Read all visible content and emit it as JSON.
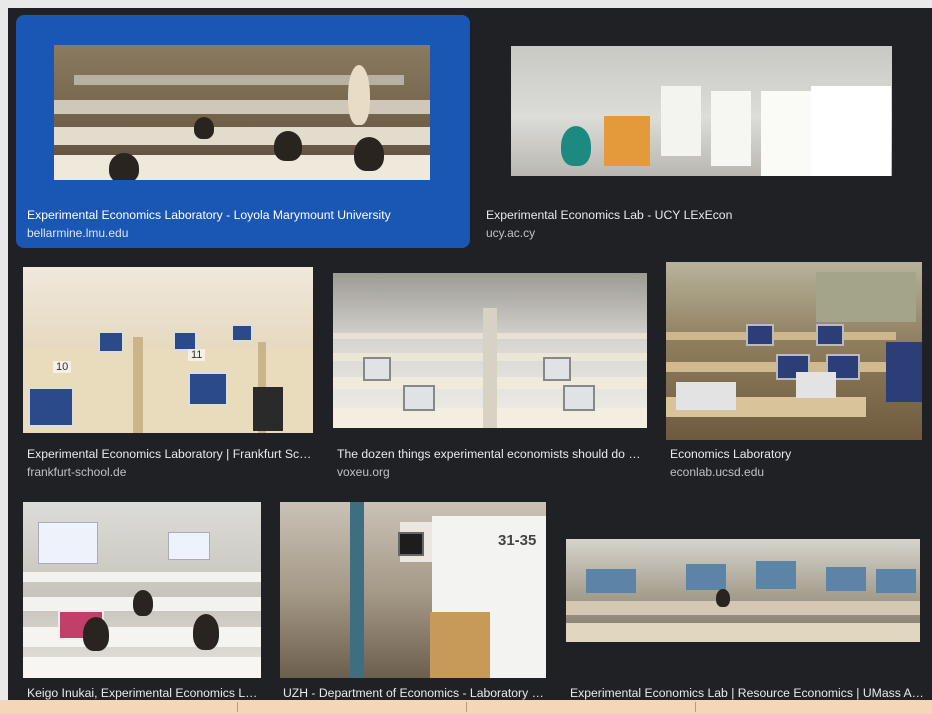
{
  "results": [
    {
      "title": "Experimental Economics Laboratory - Loyola Marymount University",
      "source": "bellarmine.lmu.edu",
      "selected": true
    },
    {
      "title": "Experimental Economics Lab - UCY LExEcon",
      "source": "ucy.ac.cy"
    },
    {
      "title": "Experimental Economics Laboratory | Frankfurt Sc…",
      "source": "frankfurt-school.de"
    },
    {
      "title": "The dozen things experimental economists should do …",
      "source": "voxeu.org"
    },
    {
      "title": "Economics Laboratory",
      "source": "econlab.ucsd.edu"
    },
    {
      "title": "Keigo Inukai, Experimental Economics L…",
      "source": ""
    },
    {
      "title": "UZH - Department of Economics - Laboratory …",
      "source": ""
    },
    {
      "title": "Experimental Economics Lab | Resource Economics | UMass A…",
      "source": ""
    }
  ],
  "photo_text": {
    "frankfurt_num_1": "10",
    "frankfurt_num_2": "11",
    "uzh_room": "31-35"
  },
  "colors": {
    "background": "#202124",
    "selected": "#1a56b4",
    "caption": "#e8eaed",
    "source": "#bdc1c6"
  }
}
